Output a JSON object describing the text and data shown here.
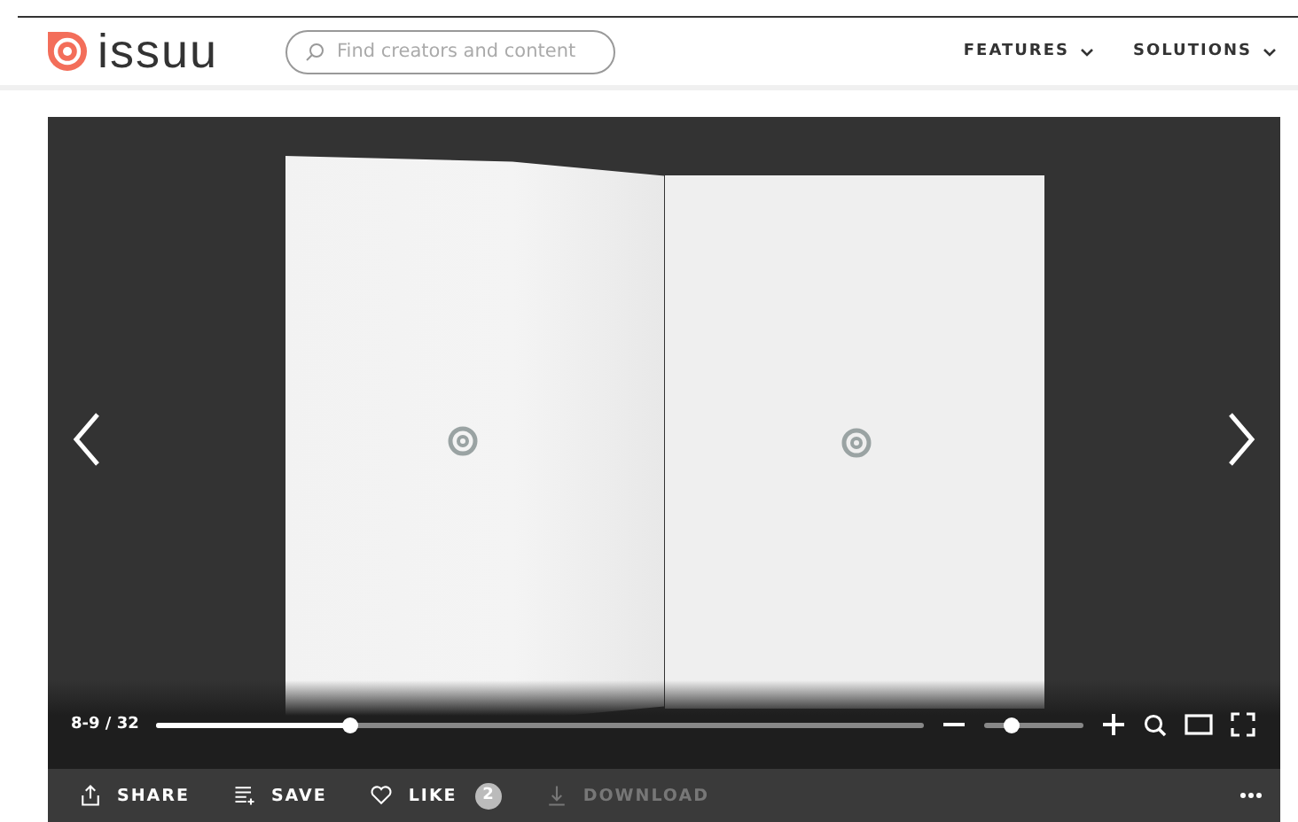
{
  "header": {
    "logo": "issuu",
    "search": {
      "placeholder": "Find creators and content"
    },
    "nav": [
      {
        "label": "FEATURES"
      },
      {
        "label": "SOLUTIONS"
      }
    ]
  },
  "viewer": {
    "page_counter": "8-9 / 32",
    "progress": {
      "level": 0.25
    },
    "zoom": {
      "level": 0.26
    }
  },
  "actions": [
    {
      "kind": "share",
      "label": "SHARE",
      "disabled": false
    },
    {
      "kind": "save",
      "label": "SAVE",
      "disabled": false
    },
    {
      "kind": "like",
      "label": "LIKE",
      "count": "2",
      "disabled": false
    },
    {
      "kind": "download",
      "label": "DOWNLOAD",
      "disabled": true
    }
  ]
}
